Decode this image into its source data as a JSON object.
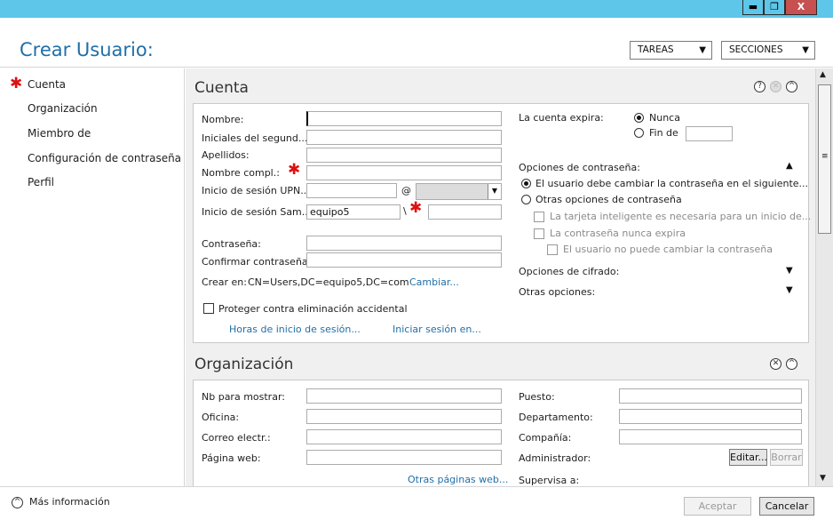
{
  "window": {
    "minimize_label": "▬",
    "maximize_label": "❐",
    "close_label": "X"
  },
  "header": {
    "title": "Crear Usuario:",
    "tasks_label": "TAREAS",
    "sections_label": "SECCIONES"
  },
  "nav": {
    "items": [
      {
        "label": "Cuenta",
        "required": true
      },
      {
        "label": "Organización"
      },
      {
        "label": "Miembro de"
      },
      {
        "label": "Configuración de contraseña"
      },
      {
        "label": "Perfil"
      }
    ]
  },
  "cuenta": {
    "title": "Cuenta",
    "help_icon": "?",
    "close_icon": "✕",
    "collapse_icon": "^",
    "fields": {
      "nombre_label": "Nombre:",
      "iniciales_label": "Iniciales del segund...",
      "apellidos_label": "Apellidos:",
      "nombre_compl_label": "Nombre compl.:",
      "upn_label": "Inicio de sesión UPN...",
      "upn_at": "@",
      "sam_label": "Inicio de sesión Sam...",
      "sam_value": "equipo5",
      "sam_sep": "\\",
      "password_label": "Contraseña:",
      "confirm_label": "Confirmar contraseña:",
      "create_in_label": "Crear en:",
      "create_in_value": "CN=Users,DC=equipo5,DC=com",
      "change_link": "Cambiar...",
      "protect_label": "Proteger contra eliminación accidental",
      "logon_hours_link": "Horas de inicio de sesión...",
      "logon_to_link": "Iniciar sesión en..."
    },
    "right": {
      "expires_label": "La cuenta expira:",
      "never_label": "Nunca",
      "end_label": "Fin de",
      "pwd_options_label": "Opciones de contraseña:",
      "must_change_label": "El usuario debe cambiar la contraseña en el siguiente...",
      "other_pwd_label": "Otras opciones de contraseña",
      "smartcard_label": "La tarjeta inteligente es necesaria para un inicio de...",
      "never_expires_label": "La contraseña nunca expira",
      "cannot_change_label": "El usuario no puede cambiar la contraseña",
      "encryption_label": "Opciones de cifrado:",
      "other_options_label": "Otras opciones:"
    }
  },
  "organizacion": {
    "title": "Organización",
    "close_icon": "✕",
    "collapse_icon": "^",
    "display_name_label": "Nb para mostrar:",
    "office_label": "Oficina:",
    "email_label": "Correo electr.:",
    "web_label": "Página web:",
    "other_web_link": "Otras páginas web...",
    "job_label": "Puesto:",
    "dept_label": "Departamento:",
    "company_label": "Compañía:",
    "manager_label": "Administrador:",
    "edit_label": "Editar...",
    "clear_label": "Borrar",
    "supervises_label": "Supervisa a:"
  },
  "footer": {
    "more_info_label": "Más información",
    "accept_label": "Aceptar",
    "cancel_label": "Cancelar"
  }
}
